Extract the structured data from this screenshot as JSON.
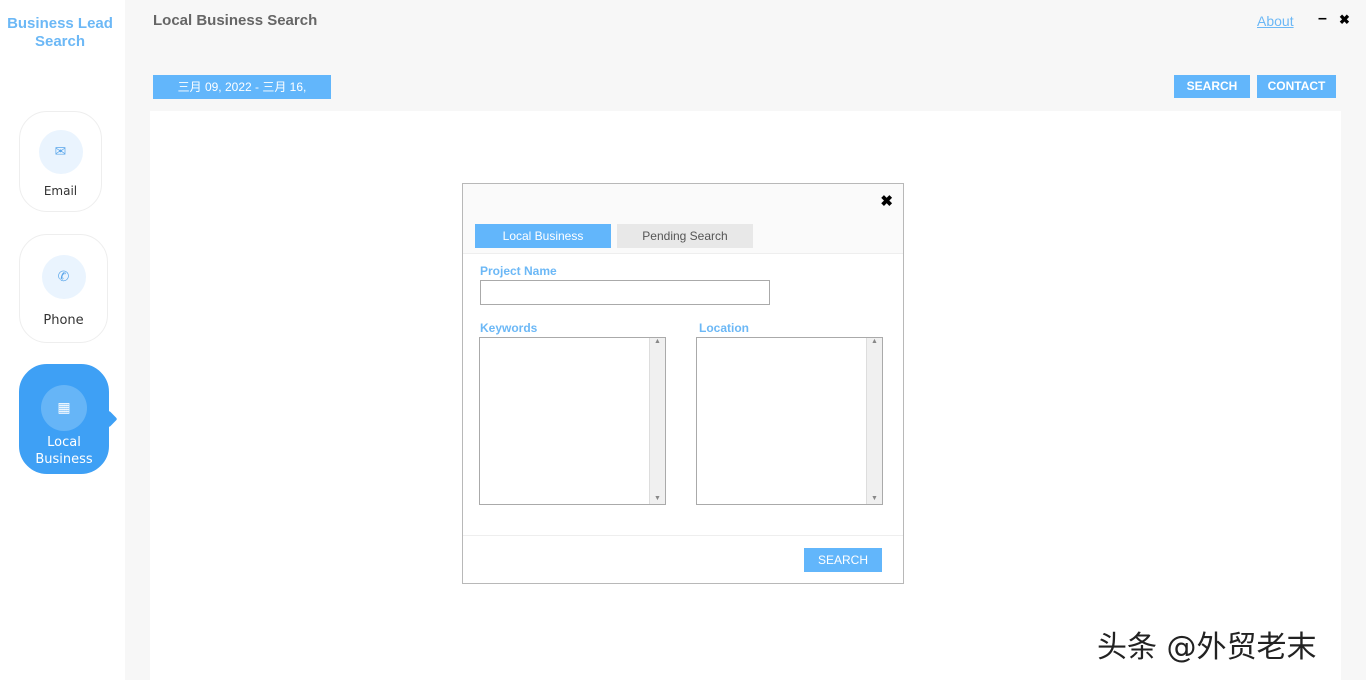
{
  "brand": "Business Lead Search",
  "sidebar": {
    "items": [
      {
        "label": "Email",
        "icon": "envelope-icon"
      },
      {
        "label": "Phone",
        "icon": "phone-icon"
      },
      {
        "label": "Local Business",
        "icon": "building-icon",
        "active": true
      }
    ]
  },
  "header": {
    "title": "Local Business Search",
    "date_range": "三月 09, 2022 - 三月 16,",
    "about": "About",
    "minimize": "–",
    "close": "✖",
    "search": "SEARCH",
    "contact": "CONTACT"
  },
  "dialog": {
    "close": "✖",
    "tabs": [
      {
        "label": "Local Business",
        "active": true
      },
      {
        "label": "Pending Search"
      }
    ],
    "project_name_label": "Project Name",
    "project_name_value": "",
    "keywords_label": "Keywords",
    "location_label": "Location",
    "search": "SEARCH"
  },
  "watermark": "头条 @外贸老末",
  "colors": {
    "accent": "#62b6fb",
    "active_nav": "#3ea0f5"
  }
}
